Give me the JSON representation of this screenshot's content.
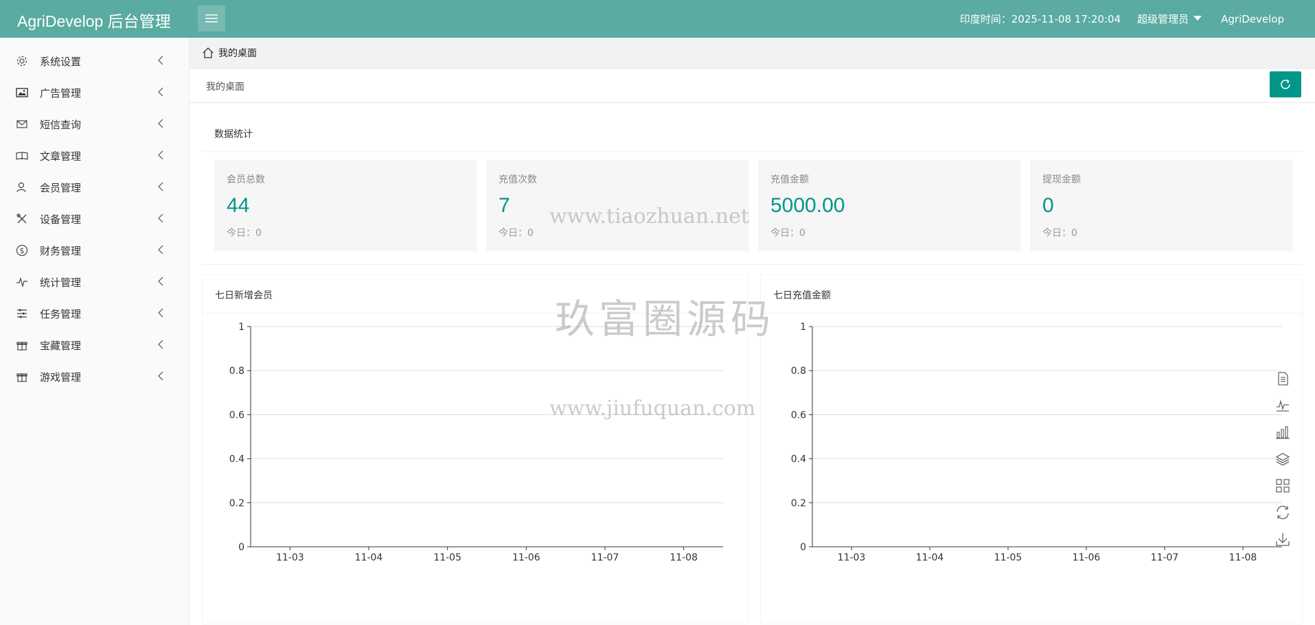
{
  "header": {
    "brand": "AgriDevelop 后台管理",
    "time": "印度时间：2025-11-08 17:20:04",
    "role": "超级管理员",
    "username": "AgriDevelop",
    "bg_color": "#5aaba2"
  },
  "sidebar": {
    "items": [
      {
        "label": "系统设置",
        "icon": "gear-icon"
      },
      {
        "label": "广告管理",
        "icon": "image-icon"
      },
      {
        "label": "短信查询",
        "icon": "mail-icon"
      },
      {
        "label": "文章管理",
        "icon": "book-icon"
      },
      {
        "label": "会员管理",
        "icon": "user-icon"
      },
      {
        "label": "设备管理",
        "icon": "tools-icon"
      },
      {
        "label": "财务管理",
        "icon": "dollar-icon"
      },
      {
        "label": "统计管理",
        "icon": "pulse-icon"
      },
      {
        "label": "任务管理",
        "icon": "sliders-icon"
      },
      {
        "label": "宝藏管理",
        "icon": "gift-icon"
      },
      {
        "label": "游戏管理",
        "icon": "gift-icon"
      }
    ]
  },
  "breadcrumb": {
    "label": "我的桌面"
  },
  "page": {
    "title": "我的桌面"
  },
  "stats": {
    "section_title": "数据统计",
    "items": [
      {
        "label": "会员总数",
        "value": "44",
        "today": "今日：0"
      },
      {
        "label": "充值次数",
        "value": "7",
        "today": "今日：0"
      },
      {
        "label": "充值金额",
        "value": "5000.00",
        "today": "今日：0"
      },
      {
        "label": "提现金额",
        "value": "0",
        "today": "今日：0"
      }
    ],
    "accent_color": "#009688"
  },
  "chart_data": [
    {
      "type": "line",
      "title": "七日新增会员",
      "categories": [
        "11-03",
        "11-04",
        "11-05",
        "11-06",
        "11-07",
        "11-08"
      ],
      "values": [],
      "yticks": [
        "0",
        "0.2",
        "0.4",
        "0.6",
        "0.8",
        "1"
      ],
      "ylim": [
        0,
        1
      ],
      "grid": true
    },
    {
      "type": "line",
      "title": "七日充值金额",
      "categories": [
        "11-03",
        "11-04",
        "11-05",
        "11-06",
        "11-07",
        "11-08"
      ],
      "values": [],
      "yticks": [
        "0",
        "0.2",
        "0.4",
        "0.6",
        "0.8",
        "1"
      ],
      "ylim": [
        0,
        1
      ],
      "grid": true
    }
  ],
  "watermarks": [
    "www.tiaozhuan.net",
    "玖富圈源码",
    "www.jiufuquan.com"
  ]
}
